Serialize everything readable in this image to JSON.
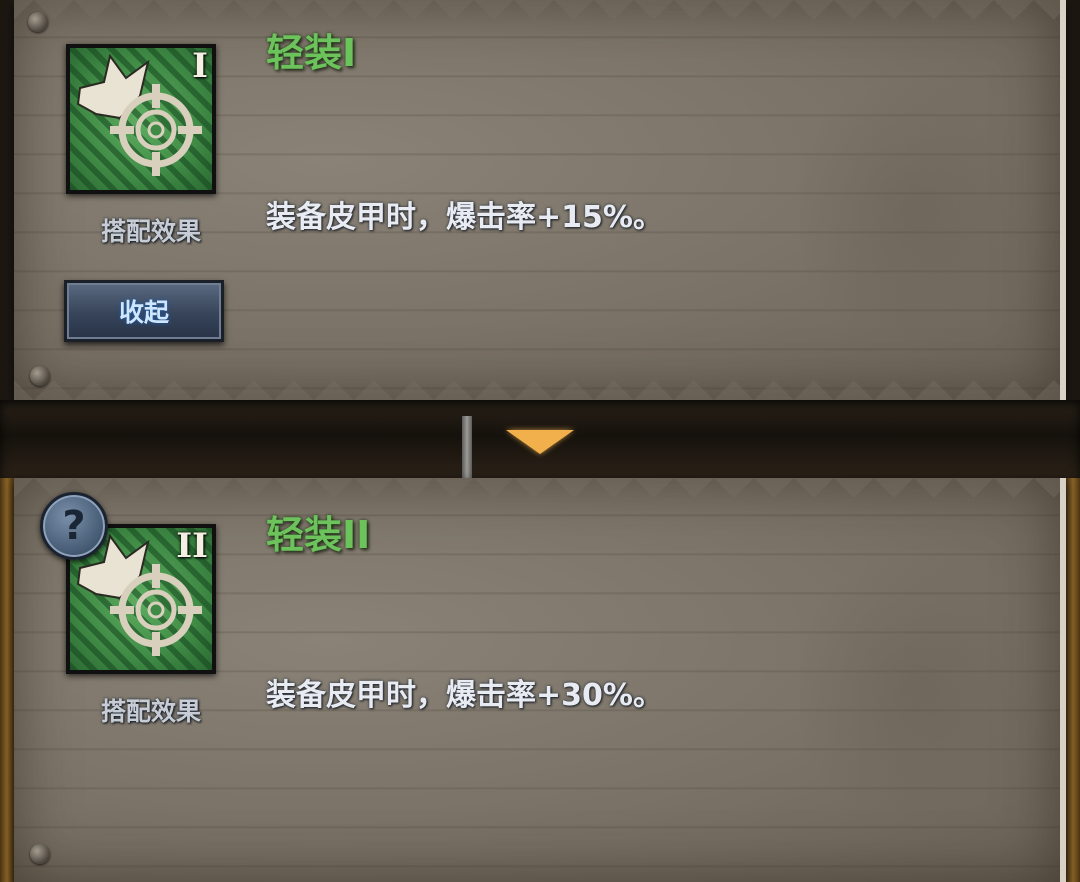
{
  "cards": [
    {
      "title": "轻装I",
      "tier_numeral": "I",
      "icon": "crosshair-burst-icon",
      "caption": "搭配效果",
      "description": "装备皮甲时，爆击率+15%。"
    },
    {
      "title": "轻装II",
      "tier_numeral": "II",
      "icon": "crosshair-burst-icon",
      "caption": "搭配效果",
      "description": "装备皮甲时，爆击率+30%。"
    }
  ],
  "collapse_button": {
    "label": "收起"
  },
  "help_button": {
    "label": "?",
    "icon": "question-mark-icon"
  },
  "expand_indicator": {
    "icon": "down-arrow-icon"
  },
  "colors": {
    "title_green": "#6cc35b",
    "panel_stone": "#7a7266",
    "button_blue": "#37445a",
    "arrow_orange": "#f2b04c"
  }
}
